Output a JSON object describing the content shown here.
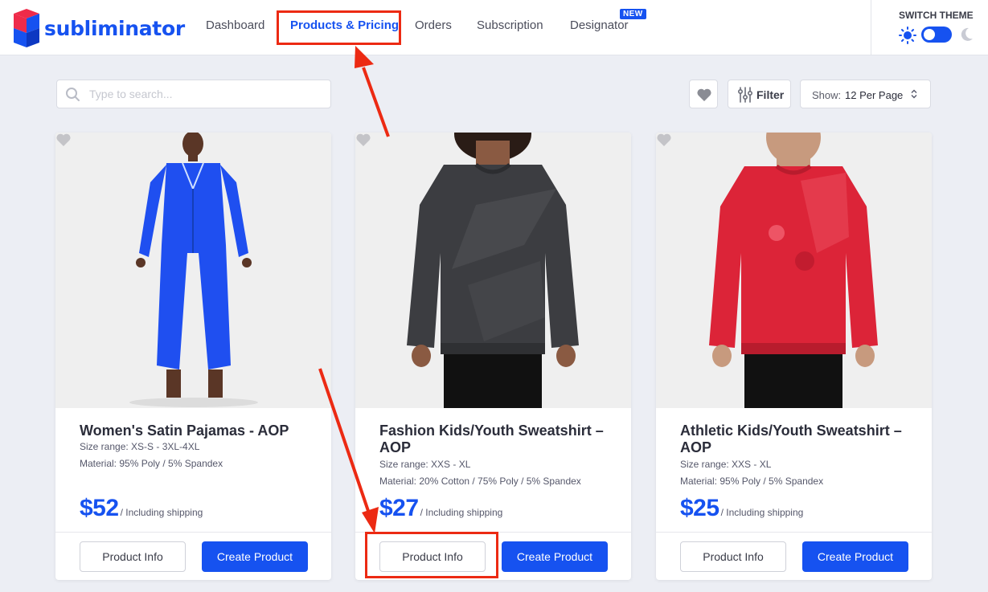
{
  "header": {
    "brand": "subliminator",
    "nav": [
      {
        "label": "Dashboard"
      },
      {
        "label": "Products & Pricing"
      },
      {
        "label": "Orders"
      },
      {
        "label": "Subscription"
      },
      {
        "label": "Designator"
      }
    ],
    "badge": "NEW",
    "theme_label": "SWITCH THEME"
  },
  "toolbar": {
    "search_placeholder": "Type to search...",
    "filter_label": "Filter",
    "show_prefix": "Show:",
    "show_value": "12 Per Page"
  },
  "products": [
    {
      "title": "Women's Satin Pajamas - AOP",
      "size_range": "Size range: XS-S - 3XL-4XL",
      "material": "Material: 95% Poly / 5% Spandex",
      "price": "$52",
      "price_note": "/ Including shipping",
      "info_label": "Product Info",
      "create_label": "Create Product",
      "color": "#1f4ff0"
    },
    {
      "title": "Fashion Kids/Youth Sweatshirt – AOP",
      "size_range": "Size range: XXS - XL",
      "material": "Material: 20% Cotton / 75% Poly / 5% Spandex",
      "price": "$27",
      "price_note": "/ Including shipping",
      "info_label": "Product Info",
      "create_label": "Create Product",
      "color": "#3c3d41"
    },
    {
      "title": "Athletic Kids/Youth Sweatshirt – AOP",
      "size_range": "Size range: XXS - XL",
      "material": "Material: 95% Poly / 5% Spandex",
      "price": "$25",
      "price_note": "/ Including shipping",
      "info_label": "Product Info",
      "create_label": "Create Product",
      "color": "#dc2438"
    }
  ],
  "colors": {
    "accent": "#1652f0",
    "annotation": "#ec2a13",
    "background": "#eceef4"
  }
}
